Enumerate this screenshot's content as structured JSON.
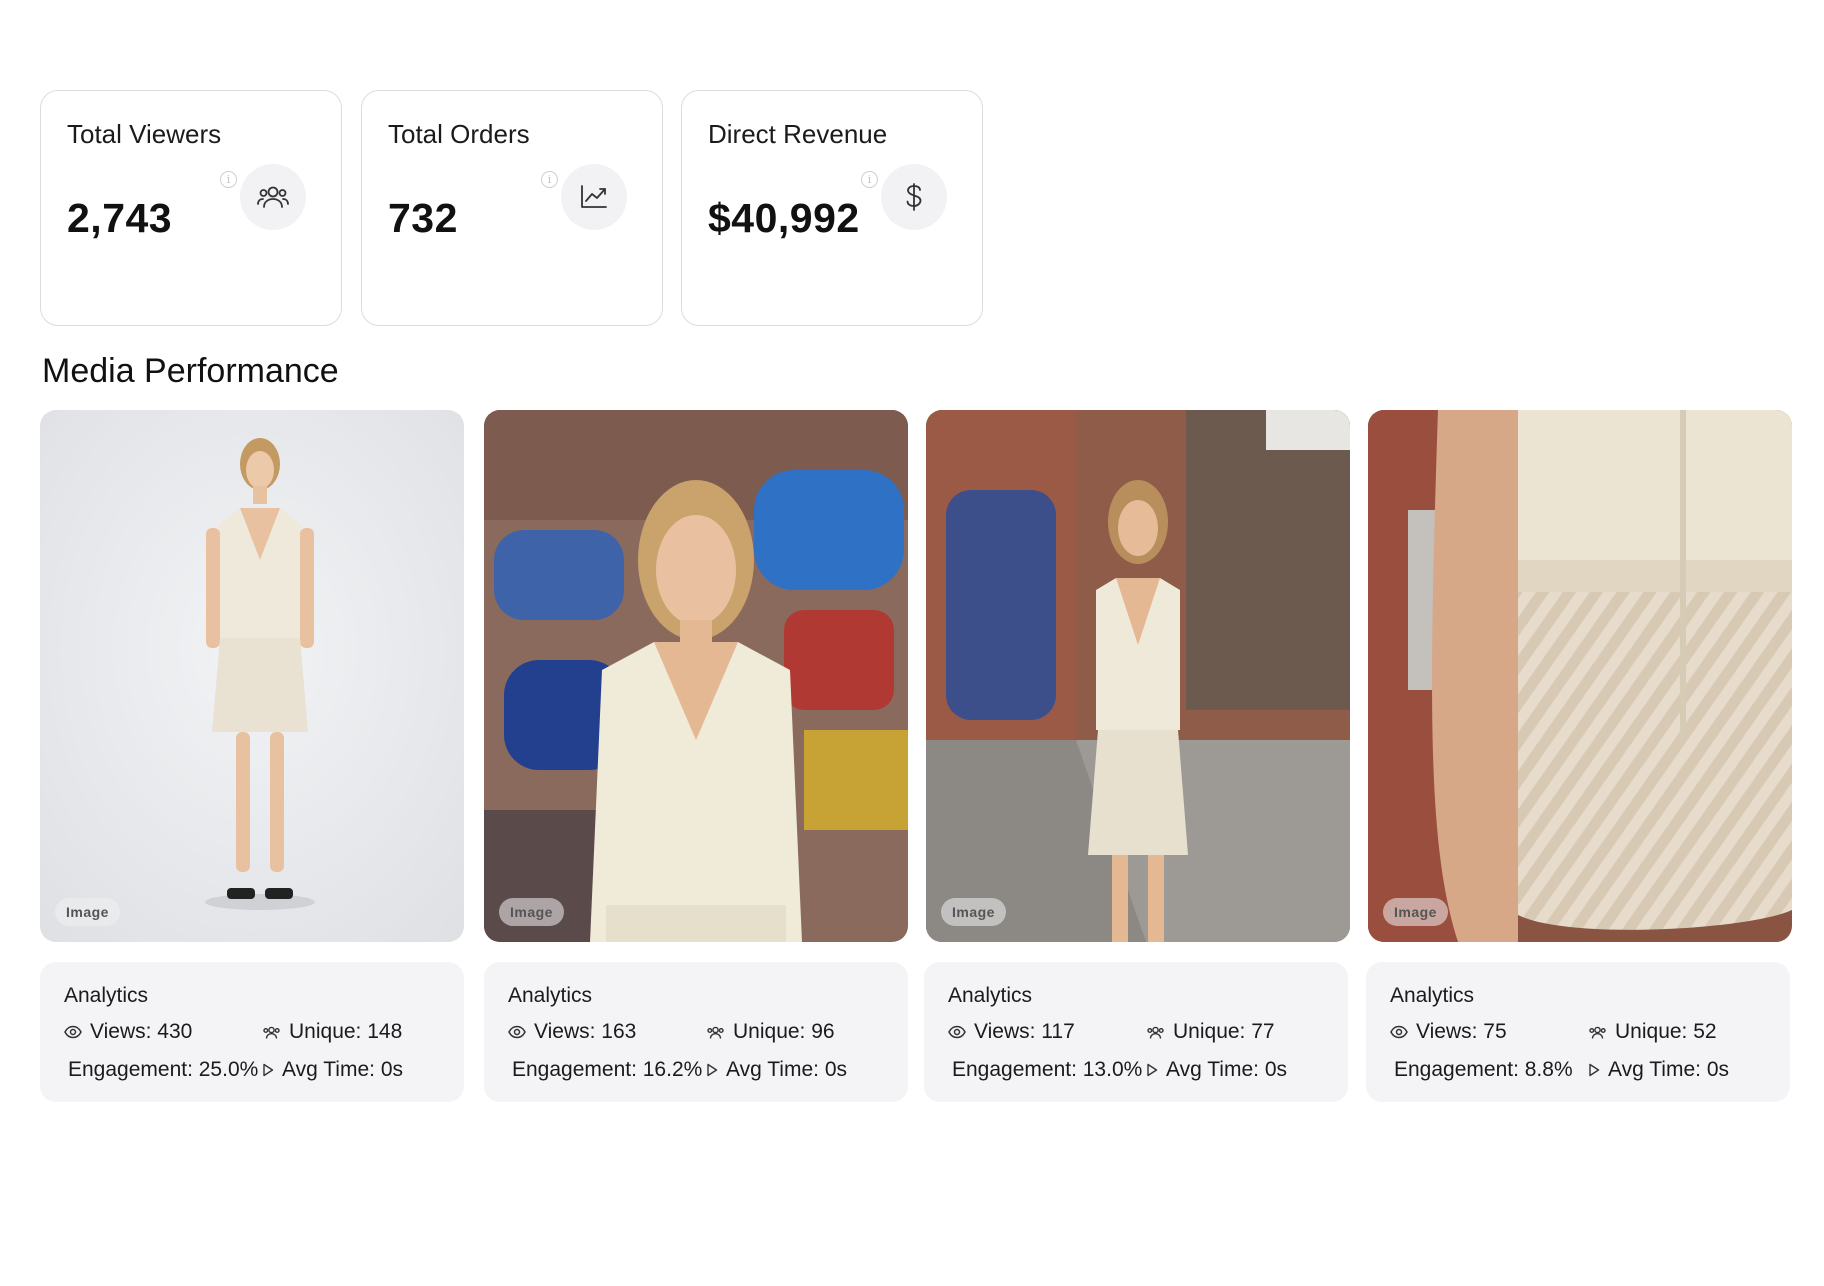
{
  "stats": [
    {
      "title": "Total Viewers",
      "value": "2,743",
      "icon": "users-icon"
    },
    {
      "title": "Total Orders",
      "value": "732",
      "icon": "trend-chart-icon"
    },
    {
      "title": "Direct Revenue",
      "value": "$40,992",
      "icon": "dollar-icon"
    }
  ],
  "info_glyph": "i",
  "section_title": "Media Performance",
  "media": [
    {
      "type": "Image",
      "analytics_title": "Analytics",
      "views": "Views: 430",
      "unique": "Unique: 148",
      "engagement": "Engagement: 25.0%",
      "avg_time": "Avg Time: 0s"
    },
    {
      "type": "Image",
      "analytics_title": "Analytics",
      "views": "Views: 163",
      "unique": "Unique: 96",
      "engagement": "Engagement: 16.2%",
      "avg_time": "Avg Time: 0s"
    },
    {
      "type": "Image",
      "analytics_title": "Analytics",
      "views": "Views: 117",
      "unique": "Unique: 77",
      "engagement": "Engagement: 13.0%",
      "avg_time": "Avg Time: 0s"
    },
    {
      "type": "Image",
      "analytics_title": "Analytics",
      "views": "Views: 75",
      "unique": "Unique: 52",
      "engagement": "Engagement: 8.8%",
      "avg_time": "Avg Time: 0s"
    }
  ]
}
